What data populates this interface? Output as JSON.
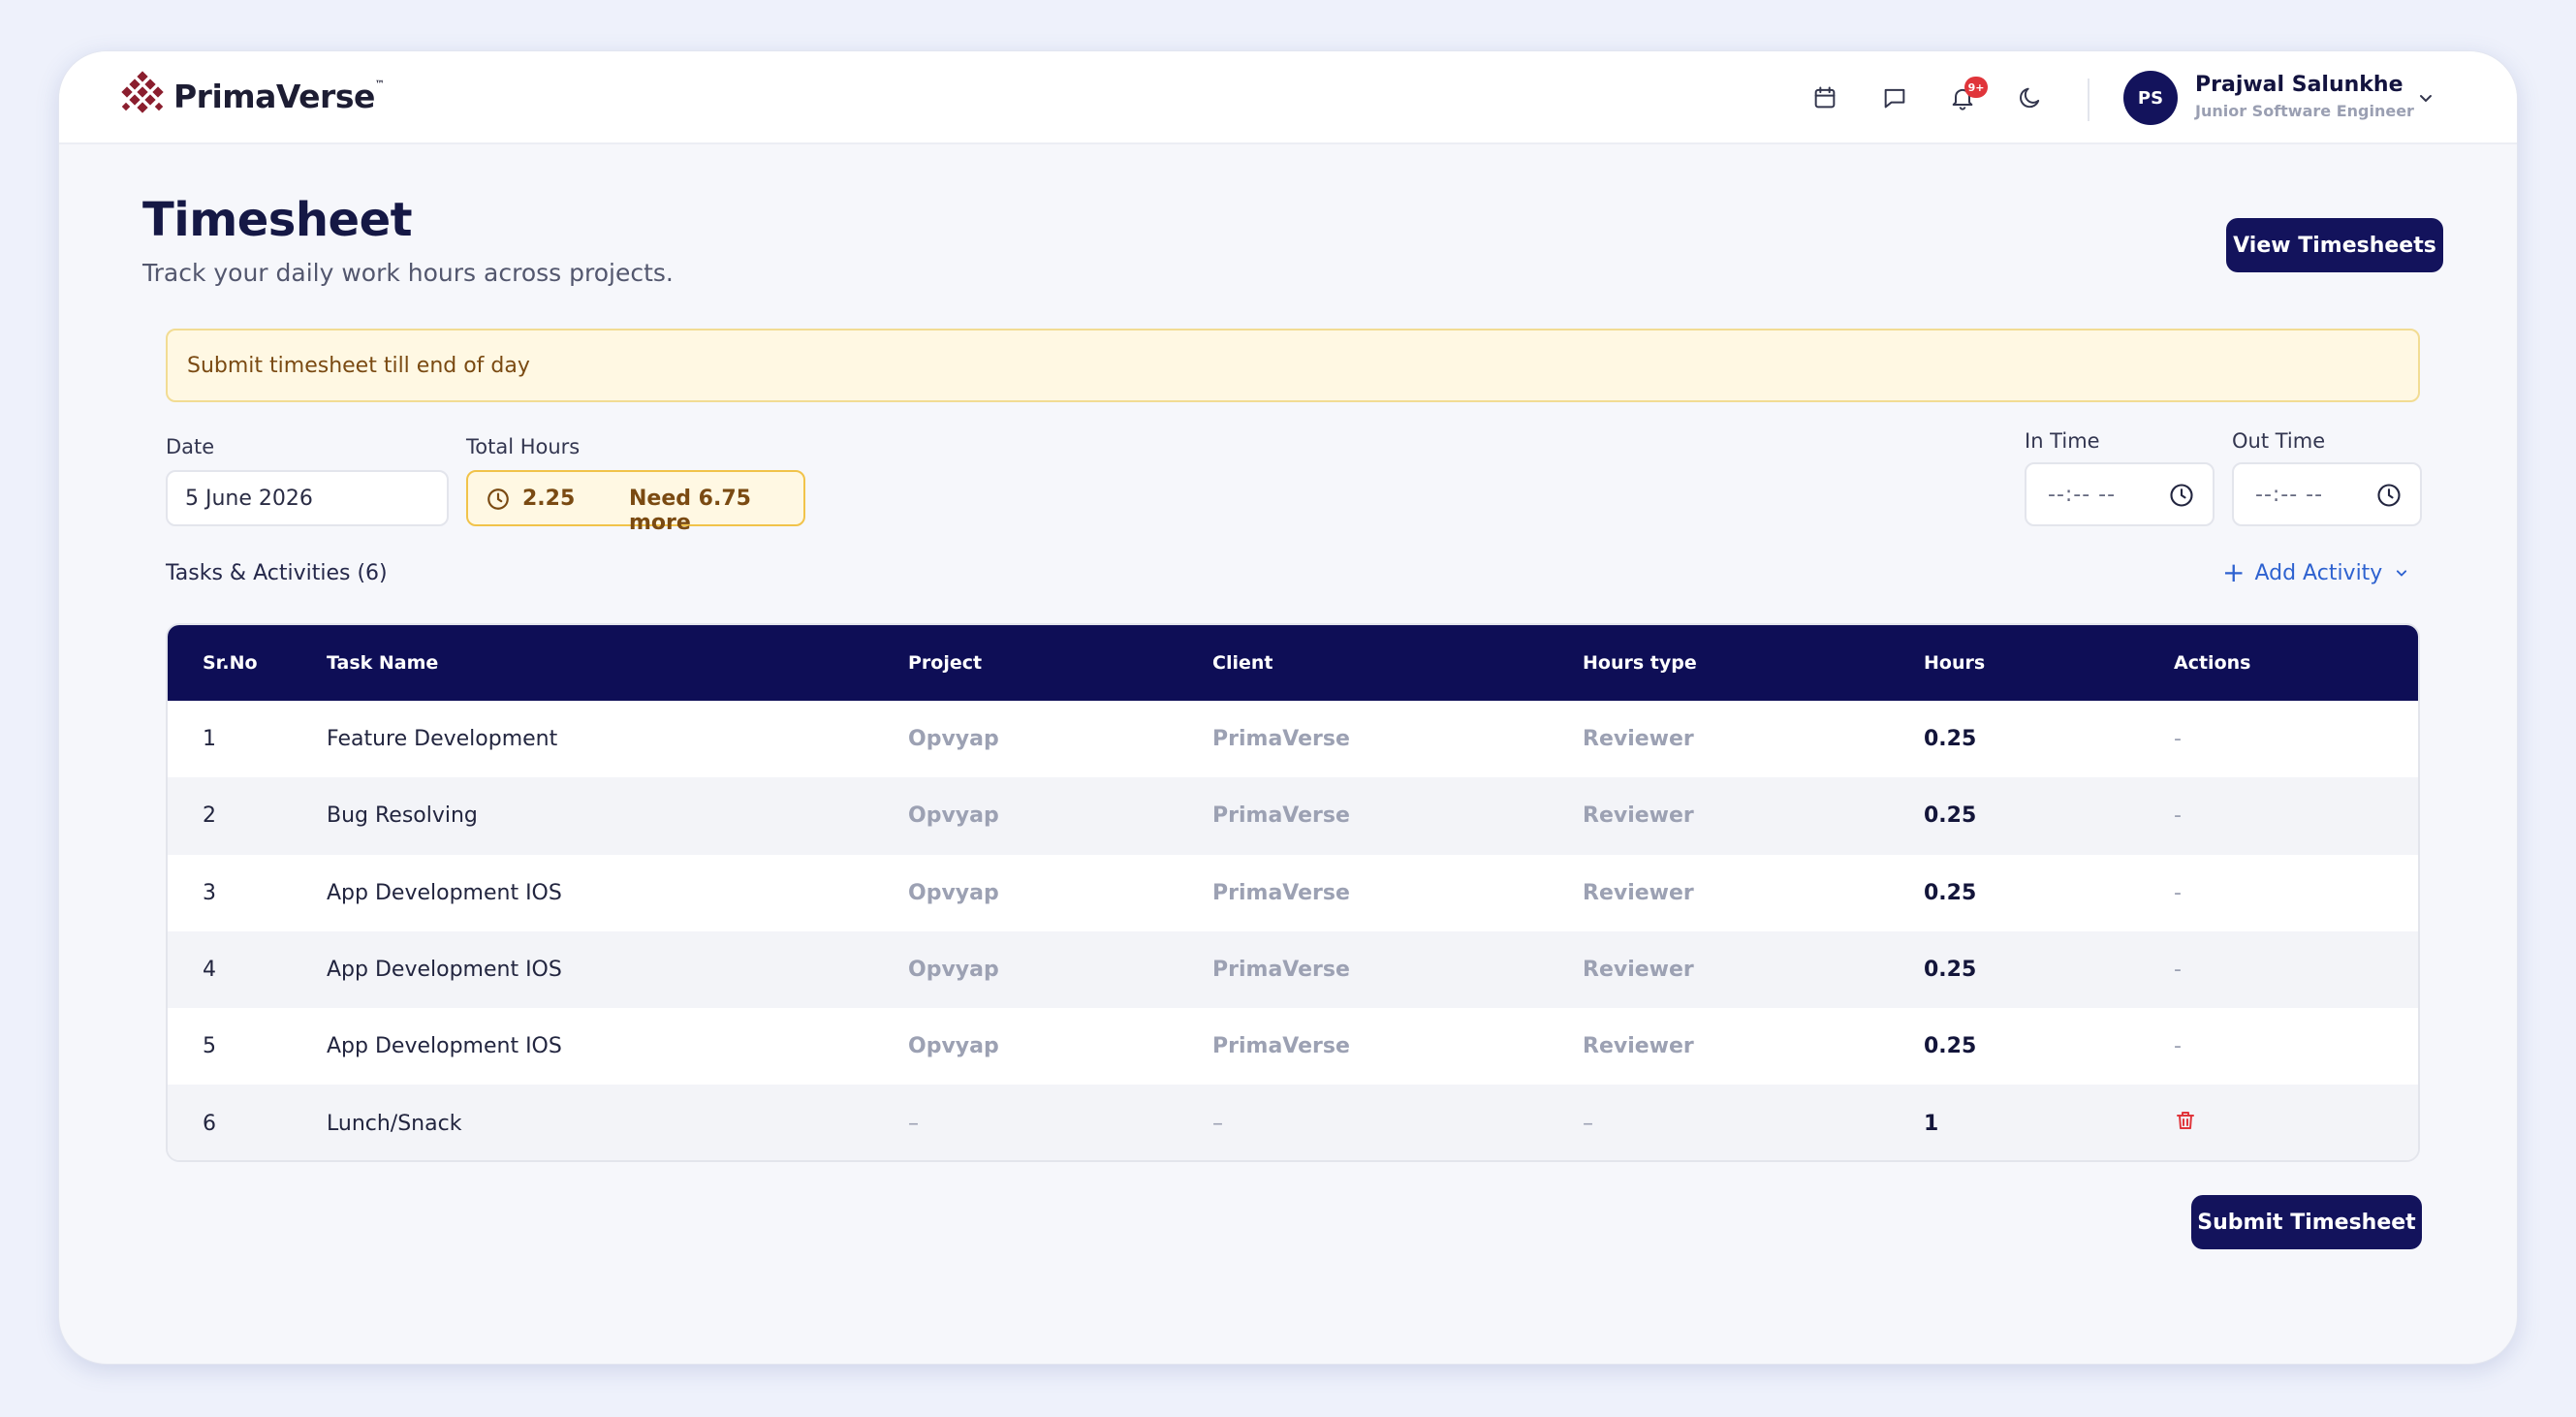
{
  "brand": {
    "name": "PrimaVerse",
    "tm": "™",
    "color": "#8b1e2e"
  },
  "header": {
    "icons": [
      "calendar-icon",
      "chat-icon",
      "bell-icon",
      "moon-icon"
    ],
    "notification_badge": "9+",
    "user": {
      "initials": "PS",
      "name": "Prajwal Salunkhe",
      "role": "Junior Software Engineer"
    }
  },
  "page": {
    "title": "Timesheet",
    "subtitle": "Track your daily work hours across projects.",
    "view_button": "View Timesheets"
  },
  "banner": {
    "text": "Submit timesheet till end of day"
  },
  "form": {
    "date_label": "Date",
    "date_value": "5 June 2026",
    "total_hours_label": "Total Hours",
    "total_hours_value": "2.25",
    "need_more": "Need 6.75 more",
    "in_time_label": "In Time",
    "in_time_placeholder": "--:-- --",
    "out_time_label": "Out Time",
    "out_time_placeholder": "--:-- --"
  },
  "tasks": {
    "label": "Tasks & Activities (6)",
    "add_activity": "Add Activity",
    "columns": [
      "Sr.No",
      "Task Name",
      "Project",
      "Client",
      "Hours type",
      "Hours",
      "Actions"
    ],
    "rows": [
      {
        "sr": "1",
        "task": "Feature Development",
        "project": "Opvyap",
        "client": "PrimaVerse",
        "type": "Reviewer",
        "hours": "0.25",
        "action": "-"
      },
      {
        "sr": "2",
        "task": "Bug Resolving",
        "project": "Opvyap",
        "client": "PrimaVerse",
        "type": "Reviewer",
        "hours": "0.25",
        "action": "-"
      },
      {
        "sr": "3",
        "task": "App Development IOS",
        "project": "Opvyap",
        "client": "PrimaVerse",
        "type": "Reviewer",
        "hours": "0.25",
        "action": "-"
      },
      {
        "sr": "4",
        "task": "App Development IOS",
        "project": "Opvyap",
        "client": "PrimaVerse",
        "type": "Reviewer",
        "hours": "0.25",
        "action": "-"
      },
      {
        "sr": "5",
        "task": "App Development IOS",
        "project": "Opvyap",
        "client": "PrimaVerse",
        "type": "Reviewer",
        "hours": "0.25",
        "action": "-"
      },
      {
        "sr": "6",
        "task": "Lunch/Snack",
        "project": "–",
        "client": "–",
        "type": "–",
        "hours": "1",
        "action": "trash-icon"
      }
    ]
  },
  "submit_button": "Submit Timesheet",
  "colors": {
    "primary": "#13135c",
    "warning_bg": "#fff8e3",
    "warning_border": "#f1c34a",
    "link": "#2e62d0",
    "danger": "#e0353b"
  }
}
